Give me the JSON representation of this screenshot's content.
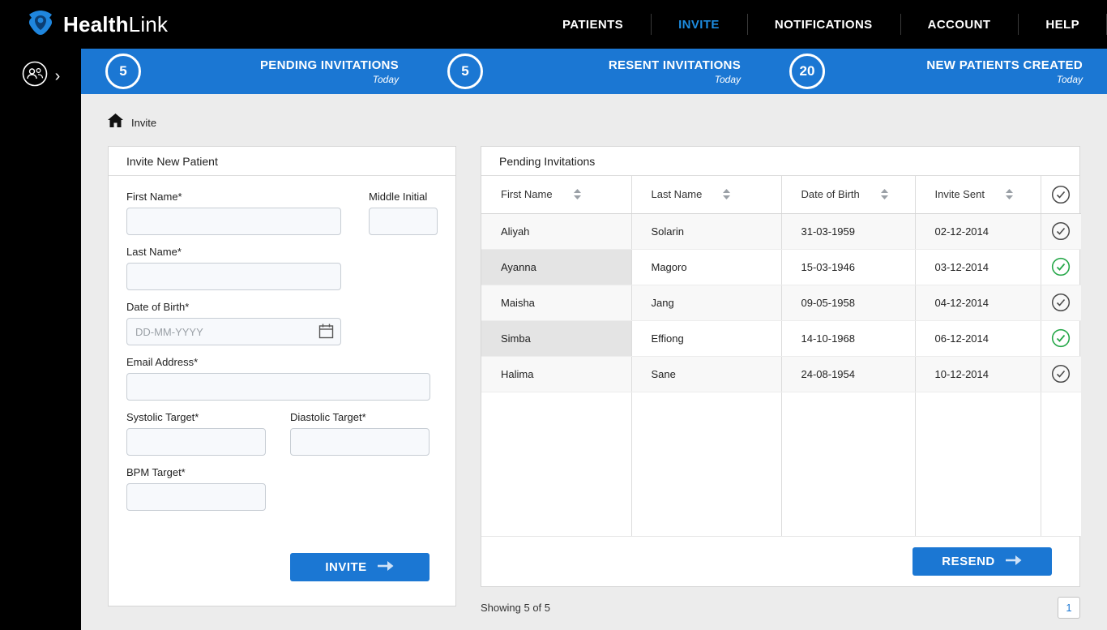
{
  "nav": {
    "brand": {
      "part1": "Health",
      "part2": "Link"
    },
    "items": [
      {
        "label": "PATIENTS",
        "active": false
      },
      {
        "label": "INVITE",
        "active": true
      },
      {
        "label": "NOTIFICATIONS",
        "active": false
      },
      {
        "label": "ACCOUNT",
        "active": false
      },
      {
        "label": "HELP",
        "active": false
      }
    ]
  },
  "stats": [
    {
      "count": "5",
      "label": "PENDING INVITATIONS",
      "sub": "Today"
    },
    {
      "count": "5",
      "label": "RESENT INVITATIONS",
      "sub": "Today"
    },
    {
      "count": "20",
      "label": "NEW PATIENTS CREATED",
      "sub": "Today"
    }
  ],
  "breadcrumb": {
    "label": "Invite"
  },
  "form": {
    "title": "Invite New Patient",
    "fields": {
      "first_name": {
        "label": "First Name*",
        "value": ""
      },
      "middle_initial": {
        "label": "Middle Initial",
        "value": ""
      },
      "last_name": {
        "label": "Last Name*",
        "value": ""
      },
      "dob": {
        "label": "Date of Birth*",
        "value": "",
        "placeholder": "DD-MM-YYYY"
      },
      "email": {
        "label": "Email Address*",
        "value": ""
      },
      "systolic": {
        "label": "Systolic Target*",
        "value": ""
      },
      "diastolic": {
        "label": "Diastolic Target*",
        "value": ""
      },
      "bpm": {
        "label": "BPM Target*",
        "value": ""
      }
    },
    "submit_label": "INVITE"
  },
  "table": {
    "title": "Pending Invitations",
    "columns": [
      "First Name",
      "Last Name",
      "Date of Birth",
      "Invite Sent"
    ],
    "rows": [
      {
        "first": "Aliyah",
        "last": "Solarin",
        "dob": "31-03-1959",
        "sent": "02-12-2014",
        "checked": false
      },
      {
        "first": "Ayanna",
        "last": "Magoro",
        "dob": "15-03-1946",
        "sent": "03-12-2014",
        "checked": true
      },
      {
        "first": "Maisha",
        "last": "Jang",
        "dob": "09-05-1958",
        "sent": "04-12-2014",
        "checked": false
      },
      {
        "first": "Simba",
        "last": "Effiong",
        "dob": "14-10-1968",
        "sent": "06-12-2014",
        "checked": true
      },
      {
        "first": "Halima",
        "last": "Sane",
        "dob": "24-08-1954",
        "sent": "10-12-2014",
        "checked": false
      }
    ],
    "resend_label": "RESEND",
    "showing": "Showing 5 of 5",
    "page": "1"
  },
  "colors": {
    "accent": "#1b77d3",
    "nav_active": "#1d8ce0",
    "check_green": "#27a84a",
    "check_gray": "#4a4a4a"
  }
}
